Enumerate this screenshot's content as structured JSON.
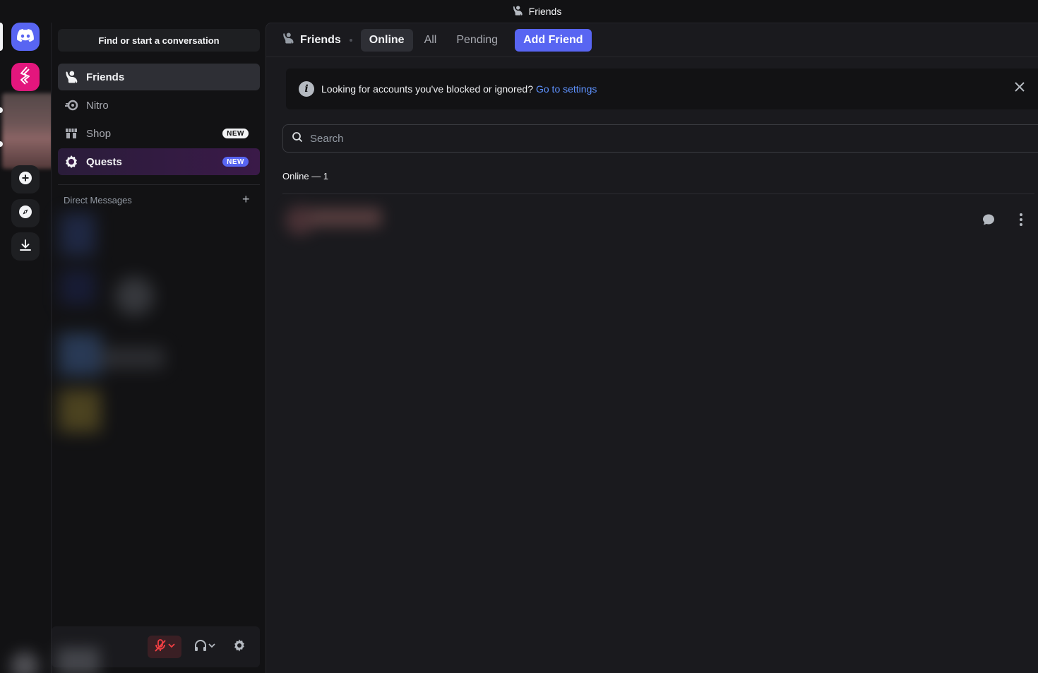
{
  "window": {
    "title": "Friends"
  },
  "rail": {
    "items": [
      {
        "name": "home",
        "icon": "discord-logo-icon"
      },
      {
        "name": "app",
        "icon": "bolt-logo-icon"
      },
      {
        "name": "add-server",
        "icon": "plus-circle-icon"
      },
      {
        "name": "explore",
        "icon": "compass-icon"
      },
      {
        "name": "download",
        "icon": "download-icon"
      }
    ]
  },
  "sidebar": {
    "search_label": "Find or start a conversation",
    "nav": [
      {
        "label": "Friends",
        "icon": "friends-icon"
      },
      {
        "label": "Nitro",
        "icon": "nitro-icon"
      },
      {
        "label": "Shop",
        "icon": "shop-icon",
        "badge": "NEW"
      },
      {
        "label": "Quests",
        "icon": "quests-icon",
        "badge": "NEW"
      }
    ],
    "dm_header": "Direct Messages",
    "dm_add": "+"
  },
  "header": {
    "title": "Friends",
    "tabs": [
      {
        "label": "Online",
        "selected": true
      },
      {
        "label": "All"
      },
      {
        "label": "Pending"
      }
    ],
    "add_friend": "Add Friend"
  },
  "notice": {
    "text": "Looking for accounts you've blocked or ignored?",
    "link": "Go to settings"
  },
  "search": {
    "placeholder": "Search"
  },
  "online_label": "Online — 1",
  "colors": {
    "accent": "#5865f2",
    "link": "#5e92ff",
    "pink_app": "#e3167d",
    "background": "#1a1a1e"
  }
}
